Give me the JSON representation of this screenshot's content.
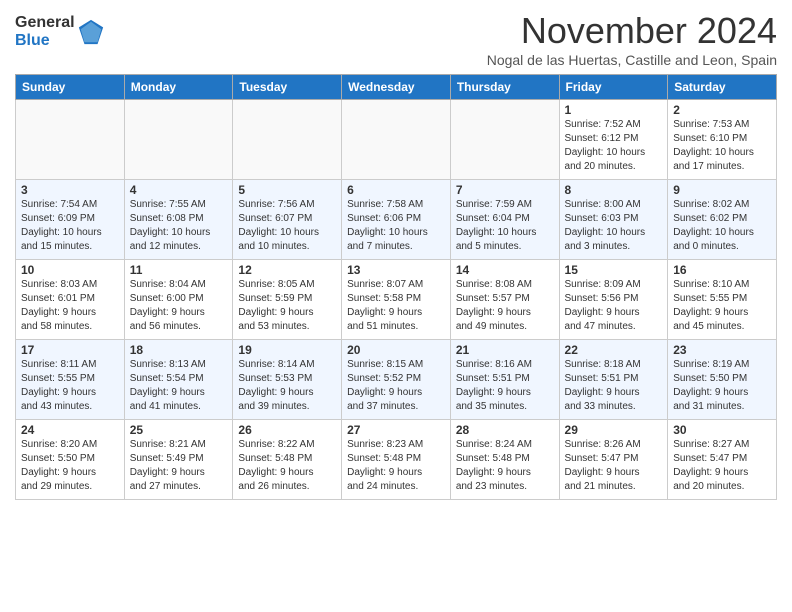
{
  "header": {
    "logo_line1": "General",
    "logo_line2": "Blue",
    "month_title": "November 2024",
    "subtitle": "Nogal de las Huertas, Castille and Leon, Spain"
  },
  "weekdays": [
    "Sunday",
    "Monday",
    "Tuesday",
    "Wednesday",
    "Thursday",
    "Friday",
    "Saturday"
  ],
  "weeks": [
    [
      {
        "day": "",
        "info": ""
      },
      {
        "day": "",
        "info": ""
      },
      {
        "day": "",
        "info": ""
      },
      {
        "day": "",
        "info": ""
      },
      {
        "day": "",
        "info": ""
      },
      {
        "day": "1",
        "info": "Sunrise: 7:52 AM\nSunset: 6:12 PM\nDaylight: 10 hours\nand 20 minutes."
      },
      {
        "day": "2",
        "info": "Sunrise: 7:53 AM\nSunset: 6:10 PM\nDaylight: 10 hours\nand 17 minutes."
      }
    ],
    [
      {
        "day": "3",
        "info": "Sunrise: 7:54 AM\nSunset: 6:09 PM\nDaylight: 10 hours\nand 15 minutes."
      },
      {
        "day": "4",
        "info": "Sunrise: 7:55 AM\nSunset: 6:08 PM\nDaylight: 10 hours\nand 12 minutes."
      },
      {
        "day": "5",
        "info": "Sunrise: 7:56 AM\nSunset: 6:07 PM\nDaylight: 10 hours\nand 10 minutes."
      },
      {
        "day": "6",
        "info": "Sunrise: 7:58 AM\nSunset: 6:06 PM\nDaylight: 10 hours\nand 7 minutes."
      },
      {
        "day": "7",
        "info": "Sunrise: 7:59 AM\nSunset: 6:04 PM\nDaylight: 10 hours\nand 5 minutes."
      },
      {
        "day": "8",
        "info": "Sunrise: 8:00 AM\nSunset: 6:03 PM\nDaylight: 10 hours\nand 3 minutes."
      },
      {
        "day": "9",
        "info": "Sunrise: 8:02 AM\nSunset: 6:02 PM\nDaylight: 10 hours\nand 0 minutes."
      }
    ],
    [
      {
        "day": "10",
        "info": "Sunrise: 8:03 AM\nSunset: 6:01 PM\nDaylight: 9 hours\nand 58 minutes."
      },
      {
        "day": "11",
        "info": "Sunrise: 8:04 AM\nSunset: 6:00 PM\nDaylight: 9 hours\nand 56 minutes."
      },
      {
        "day": "12",
        "info": "Sunrise: 8:05 AM\nSunset: 5:59 PM\nDaylight: 9 hours\nand 53 minutes."
      },
      {
        "day": "13",
        "info": "Sunrise: 8:07 AM\nSunset: 5:58 PM\nDaylight: 9 hours\nand 51 minutes."
      },
      {
        "day": "14",
        "info": "Sunrise: 8:08 AM\nSunset: 5:57 PM\nDaylight: 9 hours\nand 49 minutes."
      },
      {
        "day": "15",
        "info": "Sunrise: 8:09 AM\nSunset: 5:56 PM\nDaylight: 9 hours\nand 47 minutes."
      },
      {
        "day": "16",
        "info": "Sunrise: 8:10 AM\nSunset: 5:55 PM\nDaylight: 9 hours\nand 45 minutes."
      }
    ],
    [
      {
        "day": "17",
        "info": "Sunrise: 8:11 AM\nSunset: 5:55 PM\nDaylight: 9 hours\nand 43 minutes."
      },
      {
        "day": "18",
        "info": "Sunrise: 8:13 AM\nSunset: 5:54 PM\nDaylight: 9 hours\nand 41 minutes."
      },
      {
        "day": "19",
        "info": "Sunrise: 8:14 AM\nSunset: 5:53 PM\nDaylight: 9 hours\nand 39 minutes."
      },
      {
        "day": "20",
        "info": "Sunrise: 8:15 AM\nSunset: 5:52 PM\nDaylight: 9 hours\nand 37 minutes."
      },
      {
        "day": "21",
        "info": "Sunrise: 8:16 AM\nSunset: 5:51 PM\nDaylight: 9 hours\nand 35 minutes."
      },
      {
        "day": "22",
        "info": "Sunrise: 8:18 AM\nSunset: 5:51 PM\nDaylight: 9 hours\nand 33 minutes."
      },
      {
        "day": "23",
        "info": "Sunrise: 8:19 AM\nSunset: 5:50 PM\nDaylight: 9 hours\nand 31 minutes."
      }
    ],
    [
      {
        "day": "24",
        "info": "Sunrise: 8:20 AM\nSunset: 5:50 PM\nDaylight: 9 hours\nand 29 minutes."
      },
      {
        "day": "25",
        "info": "Sunrise: 8:21 AM\nSunset: 5:49 PM\nDaylight: 9 hours\nand 27 minutes."
      },
      {
        "day": "26",
        "info": "Sunrise: 8:22 AM\nSunset: 5:48 PM\nDaylight: 9 hours\nand 26 minutes."
      },
      {
        "day": "27",
        "info": "Sunrise: 8:23 AM\nSunset: 5:48 PM\nDaylight: 9 hours\nand 24 minutes."
      },
      {
        "day": "28",
        "info": "Sunrise: 8:24 AM\nSunset: 5:48 PM\nDaylight: 9 hours\nand 23 minutes."
      },
      {
        "day": "29",
        "info": "Sunrise: 8:26 AM\nSunset: 5:47 PM\nDaylight: 9 hours\nand 21 minutes."
      },
      {
        "day": "30",
        "info": "Sunrise: 8:27 AM\nSunset: 5:47 PM\nDaylight: 9 hours\nand 20 minutes."
      }
    ]
  ]
}
